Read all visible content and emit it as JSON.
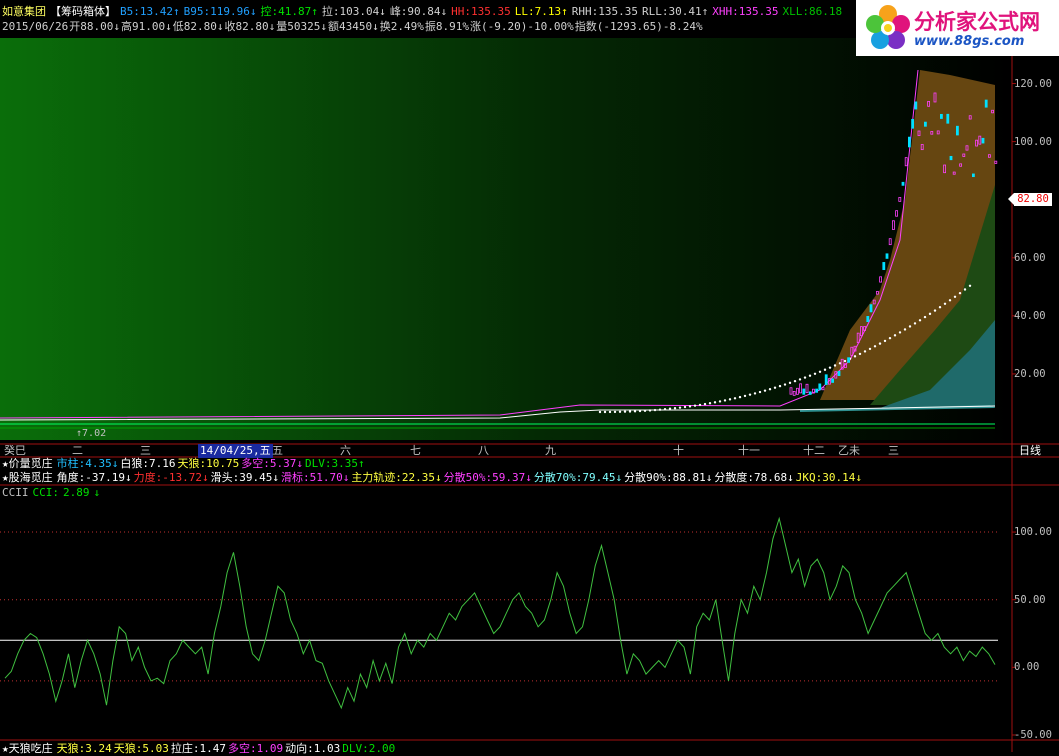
{
  "header": {
    "stock_name": "如意集团",
    "indicator_title": "【筹码箱体】",
    "line1": [
      {
        "label": "B5:",
        "value": "13.42",
        "arrow": "↑",
        "color": "#20a0ff"
      },
      {
        "label": "B95:",
        "value": "119.96",
        "arrow": "↓",
        "color": "#20a0ff"
      },
      {
        "label": "控:",
        "value": "41.87",
        "arrow": "↑",
        "color": "#00e000"
      },
      {
        "label": "拉:",
        "value": "103.04",
        "arrow": "↓",
        "color": "#d0d0d0"
      },
      {
        "label": "峰:",
        "value": "90.84",
        "arrow": "↓",
        "color": "#d0d0d0"
      },
      {
        "label": "HH:",
        "value": "135.35",
        "arrow": "",
        "color": "#ff3030"
      },
      {
        "label": "LL:",
        "value": "7.13",
        "arrow": "↑",
        "color": "#ffff00"
      },
      {
        "label": "RHH:",
        "value": "135.35",
        "arrow": "",
        "color": "#d0d0d0"
      },
      {
        "label": "RLL:",
        "value": "30.41",
        "arrow": "↑",
        "color": "#d0d0d0"
      },
      {
        "label": "XHH:",
        "value": "135.35",
        "arrow": "",
        "color": "#ff40ff"
      },
      {
        "label": "XLL:",
        "value": "86.18",
        "arrow": "",
        "color": "#00c000"
      }
    ],
    "line2": [
      {
        "label": "2015/06/26",
        "value": ""
      },
      {
        "label": "开",
        "value": "88.00",
        "arrow": "↓"
      },
      {
        "label": "高",
        "value": "91.00",
        "arrow": "↓"
      },
      {
        "label": "低",
        "value": "82.80",
        "arrow": "↓"
      },
      {
        "label": "收",
        "value": "82.80",
        "arrow": "↓"
      },
      {
        "label": "量",
        "value": "50325",
        "arrow": "↓"
      },
      {
        "label": "额",
        "value": "43450",
        "arrow": "↓"
      },
      {
        "label": "换",
        "value": "2.49%",
        "arrow": ""
      },
      {
        "label": "振",
        "value": "8.91%",
        "arrow": ""
      },
      {
        "label": "涨",
        "value": "(-9.20)-10.00%",
        "arrow": ""
      },
      {
        "label": "指数",
        "value": "(-1293.65)-8.24%",
        "arrow": ""
      }
    ]
  },
  "logo": {
    "title": "分析家公式网",
    "url": "www.88gs.com"
  },
  "main_chart": {
    "y_ticks": [
      "120.00",
      "100.00",
      "80.00",
      "60.00",
      "40.00",
      "20.00"
    ],
    "y_values": [
      120,
      100,
      80,
      60,
      40,
      20
    ],
    "y_min": 0,
    "y_max": 135,
    "current_price": "82.80",
    "low_label": "7.02",
    "colors": {
      "candle_up": "#00e0ff",
      "candle_down": "#ff40ff",
      "box_fill": "#6b4a12",
      "band_fill": "#1f6a6a"
    }
  },
  "time_tabs": {
    "tabs": [
      "癸巳",
      "二",
      "三",
      "14/04/25,五",
      "五",
      "六",
      "七",
      "八",
      "九",
      "十",
      "十一",
      "十二",
      "乙未",
      "三"
    ],
    "period": "日线"
  },
  "info_row1": {
    "prefix": "★价量觅庄",
    "items": [
      {
        "label": "市柱:",
        "value": "4.35",
        "arrow": "↓",
        "color": "#20c0ff"
      },
      {
        "label": "白狼:",
        "value": "7.16",
        "arrow": "",
        "color": "#ffffff"
      },
      {
        "label": "天狼:",
        "value": "10.75",
        "arrow": "",
        "color": "#ffff40"
      },
      {
        "label": "多空:",
        "value": "5.37",
        "arrow": "↓",
        "color": "#ff40ff"
      },
      {
        "label": "DLV:",
        "value": "3.35",
        "arrow": "↑",
        "color": "#00e000"
      }
    ]
  },
  "info_row2": {
    "prefix": "★股海觅庄",
    "items": [
      {
        "label": "角度:",
        "value": "-37.19",
        "arrow": "↓",
        "color": "#ffffff"
      },
      {
        "label": "力度:",
        "value": "-13.72",
        "arrow": "↓",
        "color": "#ff3030"
      },
      {
        "label": "滑头:",
        "value": "39.45",
        "arrow": "↓",
        "color": "#ffffff"
      },
      {
        "label": "滑标:",
        "value": "51.70",
        "arrow": "↓",
        "color": "#ff40ff"
      },
      {
        "label": "主力轨迹:",
        "value": "22.35",
        "arrow": "↓",
        "color": "#ffff40"
      },
      {
        "label": "分散50%:",
        "value": "59.37",
        "arrow": "↓",
        "color": "#ff40ff"
      },
      {
        "label": "分散70%:",
        "value": "79.45",
        "arrow": "↓",
        "color": "#80ffff"
      },
      {
        "label": "分散90%:",
        "value": "88.81",
        "arrow": "↓",
        "color": "#ffffff"
      },
      {
        "label": "分散度:",
        "value": "78.68",
        "arrow": "↓",
        "color": "#ffffff"
      },
      {
        "label": "JKQ:",
        "value": "30.14",
        "arrow": "↓",
        "color": "#ffff40"
      }
    ]
  },
  "cci_panel": {
    "title": "CCII",
    "label": "CCI:",
    "value": "2.89",
    "arrow": "↓",
    "y_ticks": [
      "100.00",
      "50.00",
      "0.00",
      "-50.00"
    ],
    "y_values": [
      100,
      50,
      0,
      -50
    ],
    "y_min": -50,
    "y_max": 120,
    "ref_lines": [
      100,
      50,
      20,
      -10
    ],
    "series": [
      -8,
      -3,
      10,
      20,
      25,
      22,
      10,
      -5,
      -25,
      -10,
      10,
      -15,
      5,
      20,
      10,
      -5,
      -28,
      5,
      30,
      25,
      5,
      15,
      0,
      -10,
      -8,
      -12,
      5,
      10,
      20,
      15,
      10,
      15,
      -5,
      25,
      45,
      70,
      85,
      60,
      30,
      10,
      5,
      20,
      40,
      60,
      55,
      35,
      25,
      10,
      20,
      5,
      3,
      -10,
      -20,
      -30,
      -15,
      -25,
      -5,
      -15,
      5,
      -10,
      3,
      -12,
      15,
      25,
      10,
      20,
      15,
      25,
      20,
      30,
      40,
      35,
      45,
      50,
      55,
      45,
      35,
      25,
      30,
      40,
      50,
      55,
      45,
      40,
      30,
      35,
      50,
      70,
      60,
      40,
      25,
      30,
      50,
      75,
      90,
      70,
      50,
      20,
      -5,
      10,
      5,
      -5,
      0,
      5,
      0,
      10,
      20,
      15,
      -5,
      30,
      40,
      35,
      50,
      20,
      -10,
      25,
      50,
      40,
      60,
      50,
      70,
      95,
      110,
      90,
      70,
      80,
      60,
      75,
      80,
      70,
      50,
      60,
      75,
      70,
      50,
      40,
      25,
      35,
      45,
      55,
      60,
      65,
      70,
      55,
      40,
      25,
      20,
      25,
      15,
      10,
      15,
      5,
      12,
      8,
      15,
      10,
      2
    ]
  },
  "bottom_row": {
    "prefix": "★天狼吃庄",
    "items": [
      {
        "label": "天狼:",
        "value": "3.24",
        "color": "#ffff40"
      },
      {
        "label": "天狼:",
        "value": "5.03",
        "color": "#ffff40"
      },
      {
        "label": "拉庄:",
        "value": "1.47",
        "color": "#ffffff"
      },
      {
        "label": "多空:",
        "value": "1.09",
        "color": "#ff40ff"
      },
      {
        "label": "动向:",
        "value": "1.03",
        "color": "#ffffff"
      },
      {
        "label": "DLV:",
        "value": "2.00",
        "color": "#00e000"
      }
    ]
  }
}
